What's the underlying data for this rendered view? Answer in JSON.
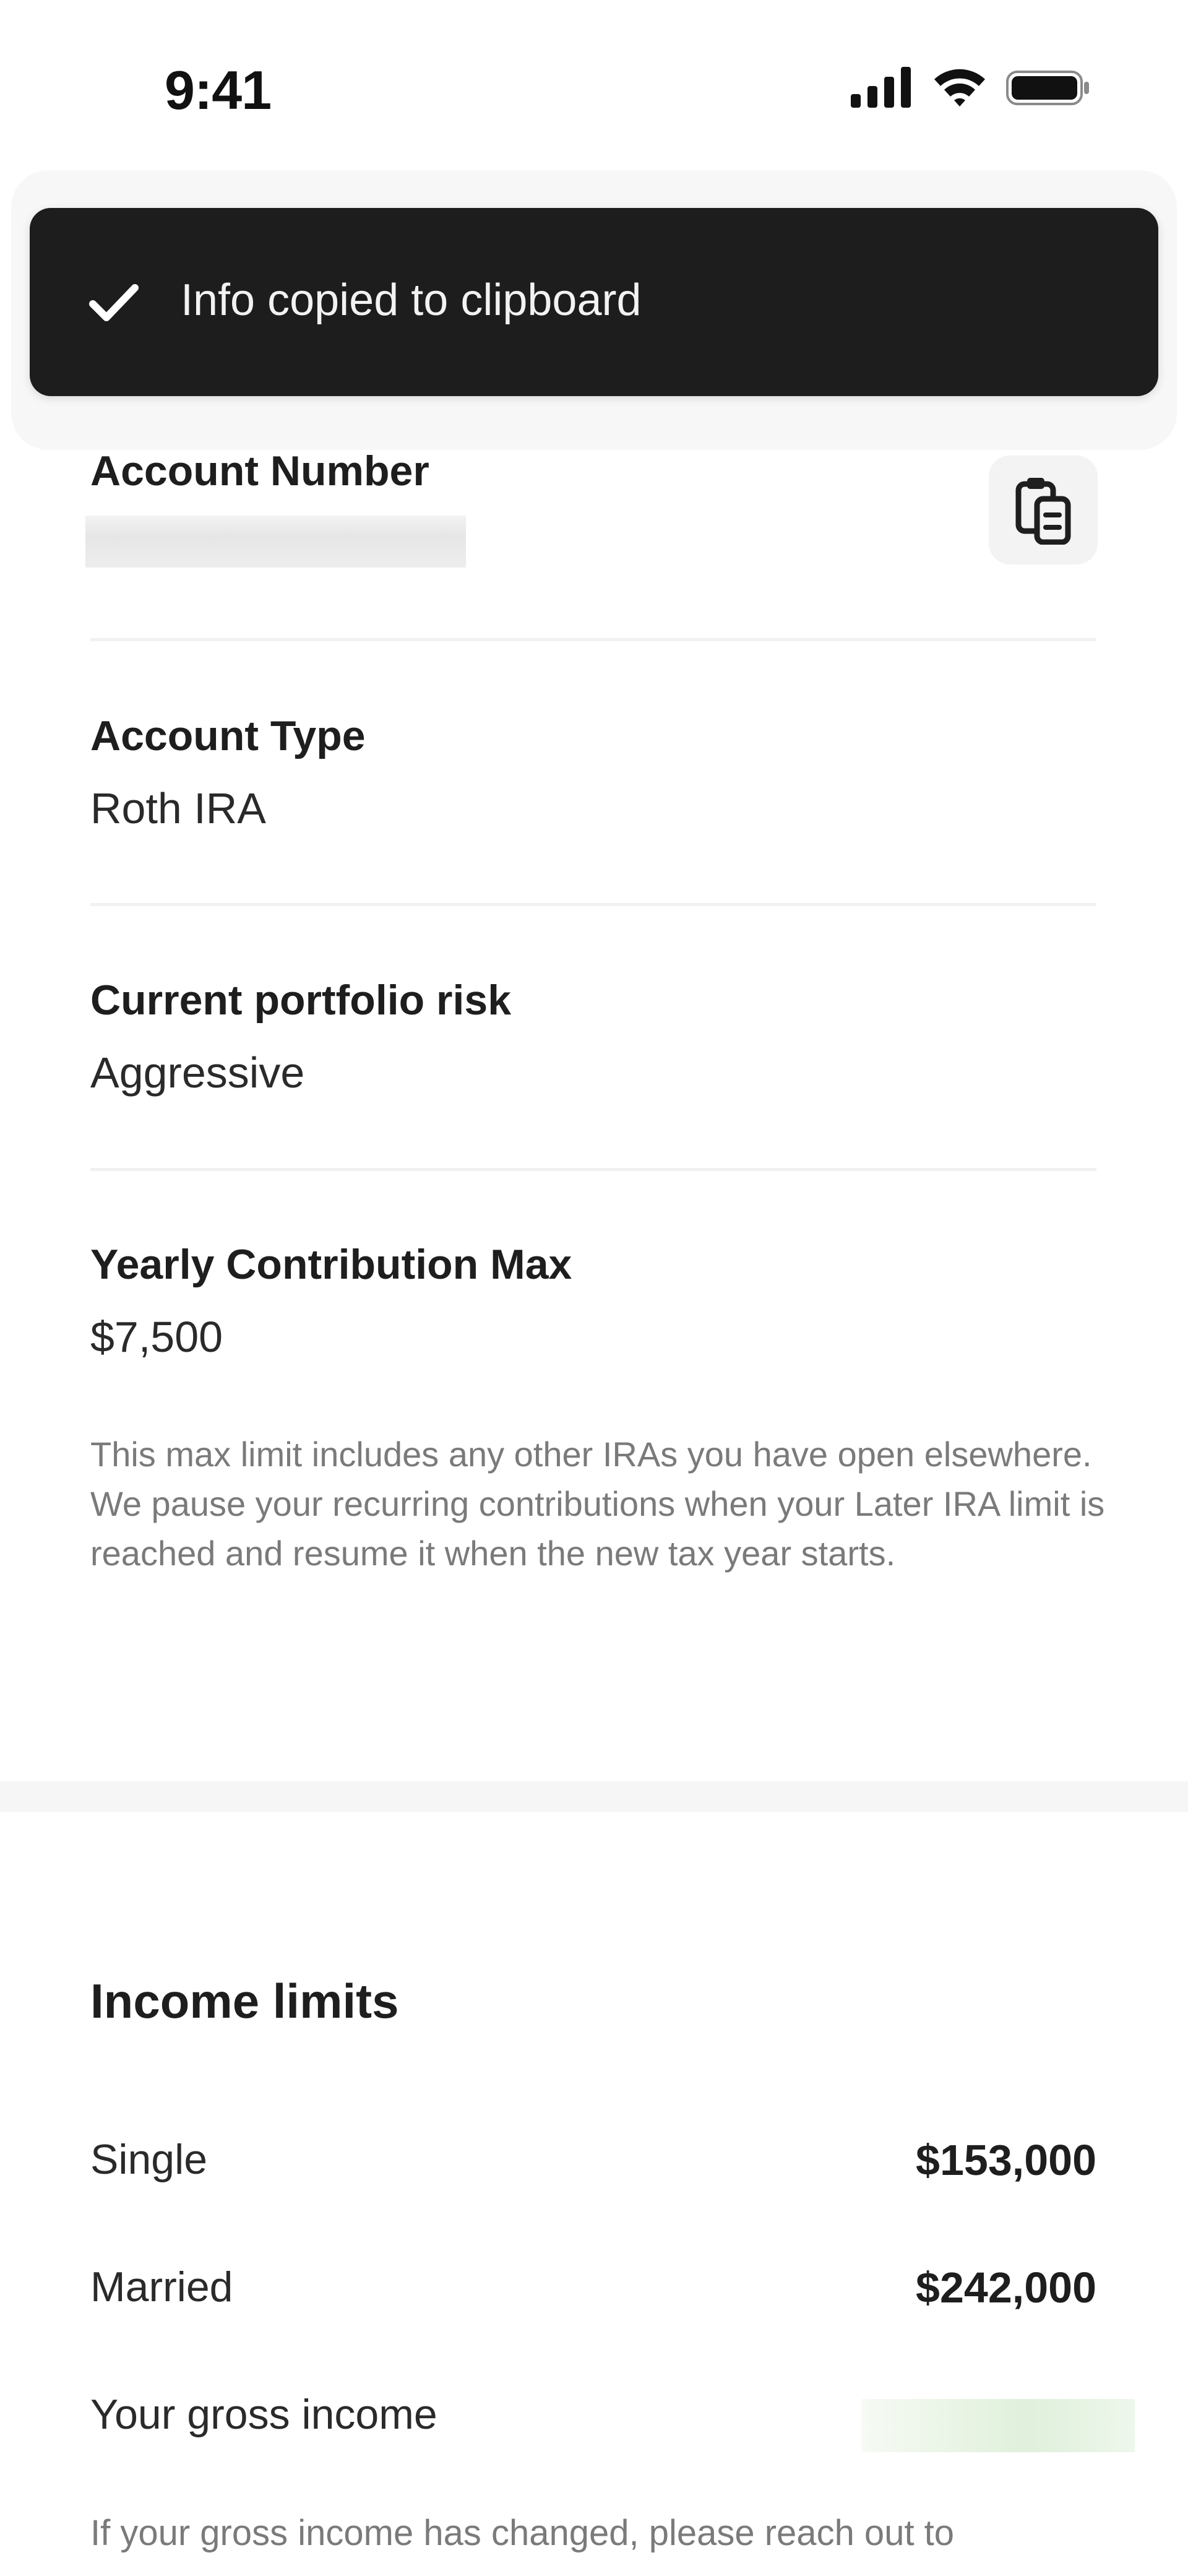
{
  "status_bar": {
    "time": "9:41",
    "icons": [
      "signal-icon",
      "wifi-icon",
      "battery-icon"
    ]
  },
  "toast": {
    "message": "Info copied to clipboard",
    "icon": "check-icon"
  },
  "account": {
    "number_label": "Account Number",
    "copy_icon": "clipboard-copy-icon",
    "type_label": "Account Type",
    "type_value": "Roth IRA",
    "risk_label": "Current portfolio risk",
    "risk_value": "Aggressive",
    "max_label": "Yearly Contribution Max",
    "max_value": "$7,500",
    "max_note": "This max limit includes any other IRAs you have open elsewhere. We pause your recurring contributions when your Later IRA limit is reached and resume it when the new tax year starts."
  },
  "income_limits": {
    "title": "Income limits",
    "rows": [
      {
        "label": "Single",
        "value": "$153,000"
      },
      {
        "label": "Married",
        "value": "$242,000"
      }
    ],
    "gross_label": "Your gross income",
    "note": "If your gross income has changed, please reach out to"
  },
  "colors": {
    "toast_bg": "#1d1d1d",
    "divider": "#f1f1f1",
    "muted_text": "#7a7a7a"
  }
}
